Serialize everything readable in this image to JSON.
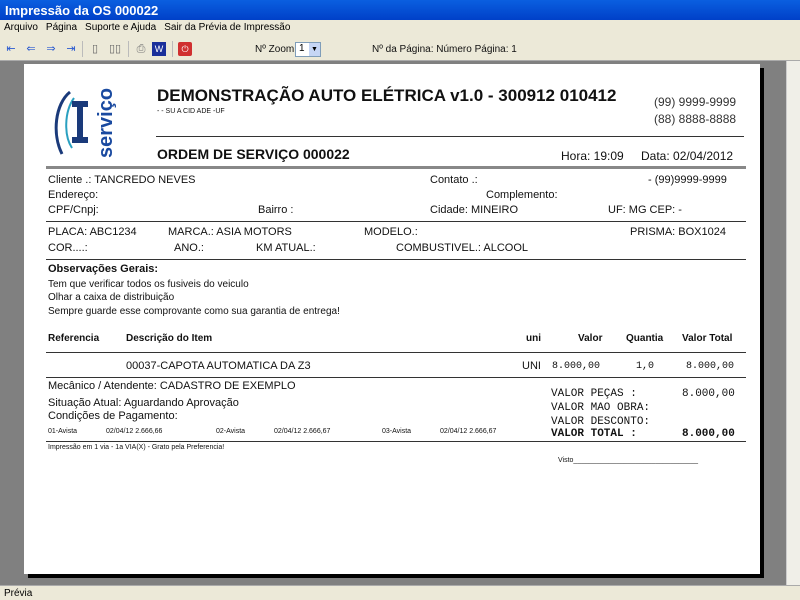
{
  "window": {
    "title": "Impressão da OS 000022"
  },
  "menu": [
    "Arquivo",
    "Página",
    "Suporte e Ajuda",
    "Sair da Prévia de Impressão"
  ],
  "toolbar": {
    "zoom_label": "Nº Zoom",
    "zoom_value": "1",
    "page_label": "Nº da Página: Número Página: 1"
  },
  "status": "Prévia",
  "doc": {
    "logo_text": "serviço",
    "company": "DEMONSTRAÇÃO AUTO ELÉTRICA v1.0 - 300912 010412",
    "city": "- - SU A CID ADE -UF",
    "phone1": "(99) 9999-9999",
    "phone2": "(88) 8888-8888",
    "os_title": "ORDEM DE SERVIÇO 000022",
    "hora": "Hora: 19:09",
    "data": "Data: 02/04/2012",
    "cliente": "Cliente    .: TANCREDO NEVES",
    "contato": "Contato .:",
    "fone": "- (99)9999-9999",
    "endereco": "Endereço:",
    "complemento": "Complemento:",
    "cpf": "CPF/Cnpj:",
    "bairro": "Bairro :",
    "cidade": "Cidade: MINEIRO",
    "uf": "UF: MG CEP:   -",
    "placa": "PLACA: ABC1234",
    "marca": "MARCA.: ASIA MOTORS",
    "modelo": "MODELO.:",
    "prisma": "PRISMA: BOX1024",
    "cor": "COR....:",
    "ano": "ANO.:",
    "km": "KM ATUAL.:",
    "combustivel": "COMBUSTIVEL.: ALCOOL",
    "obs_title": "Observações Gerais:",
    "obs": [
      "Tem que verificar todos os fusiveis do veiculo",
      "Olhar a caixa de distribuição",
      "Sempre guarde esse comprovante como sua garantia de entrega!"
    ],
    "cols": [
      "Referencia",
      "Descrição do Item",
      "uni",
      "Valor",
      "Quantia",
      "Valor Total"
    ],
    "items": [
      {
        "desc": "00037-CAPOTA AUTOMATICA DA Z3",
        "uni": "UNI",
        "valor": "8.000,00",
        "qtd": "1,0",
        "total": "8.000,00"
      }
    ],
    "mecanico": "Mecânico / Atendente: CADASTRO DE EXEMPLO",
    "situacao": "Situação Atual: Aguardando Aprovação",
    "condicoes": "Condições de Pagamento:",
    "parcelas": [
      {
        "n": "01-Avista",
        "v": "02/04/12  2.666,66"
      },
      {
        "n": "02-Avista",
        "v": "02/04/12  2.666,67"
      },
      {
        "n": "03-Avista",
        "v": "02/04/12  2.666,67"
      }
    ],
    "totais": [
      {
        "l": "VALOR PEÇAS    :",
        "v": "8.000,00"
      },
      {
        "l": "VALOR MAO OBRA:",
        "v": ""
      },
      {
        "l": "VALOR DESCONTO:",
        "v": ""
      },
      {
        "l": "VALOR TOTAL    :",
        "v": "8.000,00"
      }
    ],
    "rodape": "Impressão em 1 via  -  1a VIA(X) - Grato pela Preferencia!",
    "visto": "Visto________________________________"
  }
}
